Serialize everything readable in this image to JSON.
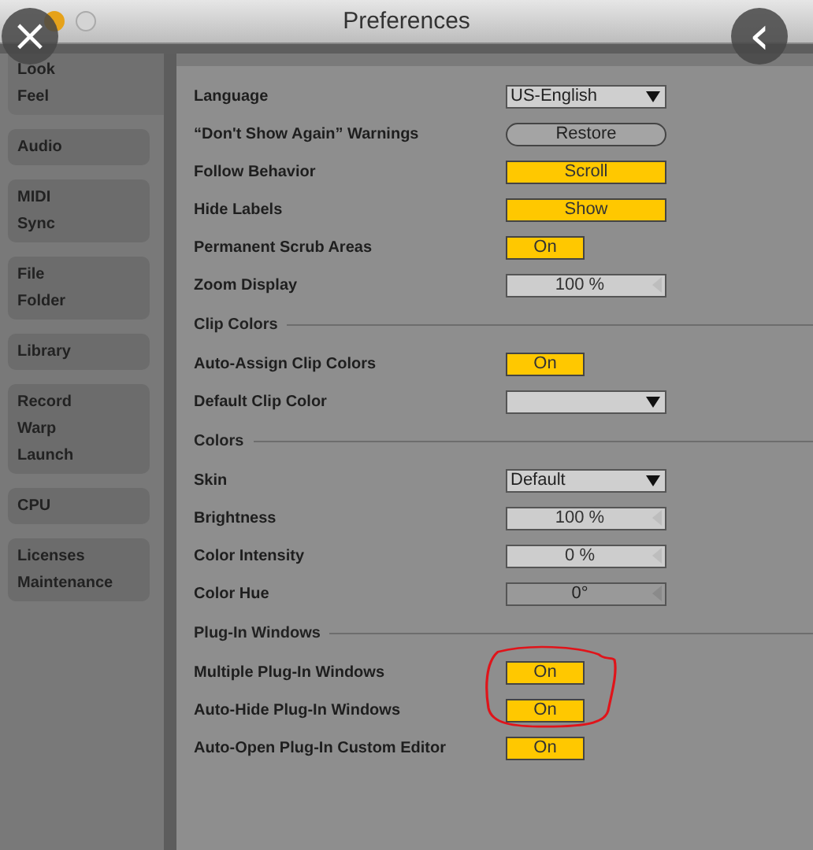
{
  "window": {
    "title": "Preferences"
  },
  "overlay": {
    "close": "×",
    "back": "‹"
  },
  "sidebar": {
    "groups": [
      {
        "items": [
          "Look",
          "Feel"
        ],
        "selected": true
      },
      {
        "items": [
          "Audio"
        ],
        "selected": false
      },
      {
        "items": [
          "MIDI",
          "Sync"
        ],
        "selected": false
      },
      {
        "items": [
          "File",
          "Folder"
        ],
        "selected": false
      },
      {
        "items": [
          "Library"
        ],
        "selected": false
      },
      {
        "items": [
          "Record",
          "Warp",
          "Launch"
        ],
        "selected": false
      },
      {
        "items": [
          "CPU"
        ],
        "selected": false
      },
      {
        "items": [
          "Licenses",
          "Maintenance"
        ],
        "selected": false
      }
    ]
  },
  "rows": [
    {
      "kind": "dropdown",
      "label": "Language",
      "value": "US-English"
    },
    {
      "kind": "button",
      "label": "“Don't Show Again” Warnings",
      "value": "Restore"
    },
    {
      "kind": "toggle",
      "label": "Follow Behavior",
      "value": "Scroll",
      "on": true,
      "wide": true
    },
    {
      "kind": "toggle",
      "label": "Hide Labels",
      "value": "Show",
      "on": true,
      "wide": true
    },
    {
      "kind": "toggle",
      "label": "Permanent Scrub Areas",
      "value": "On",
      "on": true,
      "wide": false
    },
    {
      "kind": "field",
      "label": "Zoom Display",
      "value": "100 %",
      "disabled": false
    },
    {
      "kind": "section",
      "label": "Clip Colors"
    },
    {
      "kind": "toggle",
      "label": "Auto-Assign Clip Colors",
      "value": "On",
      "on": true,
      "wide": false
    },
    {
      "kind": "dropdown",
      "label": "Default Clip Color"
    },
    {
      "kind": "section",
      "label": "Colors"
    },
    {
      "kind": "dropdown",
      "label": "Skin",
      "value": "Default"
    },
    {
      "kind": "field",
      "label": "Brightness",
      "value": "100 %",
      "disabled": false
    },
    {
      "kind": "field",
      "label": "Color Intensity",
      "value": "0 %",
      "disabled": false
    },
    {
      "kind": "field",
      "label": "Color Hue",
      "value": "0°",
      "disabled": true
    },
    {
      "kind": "section",
      "label": "Plug-In Windows"
    },
    {
      "kind": "toggle",
      "label": "Multiple Plug-In Windows",
      "value": "On",
      "on": true,
      "wide": false
    },
    {
      "kind": "toggle",
      "label": "Auto-Hide Plug-In Windows",
      "value": "On",
      "on": true,
      "wide": false
    },
    {
      "kind": "toggle",
      "label": "Auto-Open Plug-In Custom Editor",
      "value": "On",
      "on": true,
      "wide": false
    }
  ]
}
